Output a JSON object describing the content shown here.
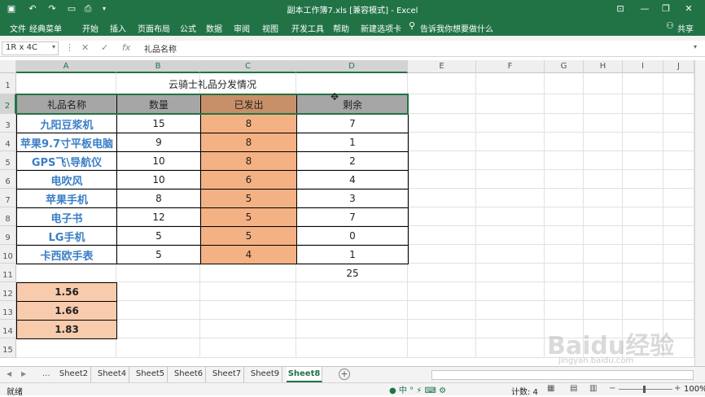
{
  "title": "副本工作簿7.xls  [兼容模式]  -  Excel",
  "window": {
    "minimize": "—",
    "restore": "❐",
    "close": "✕",
    "ribbon_toggle": "⊡"
  },
  "menu": {
    "tabs": [
      "文件",
      "经典菜单",
      "开始",
      "插入",
      "页面布局",
      "公式",
      "数据",
      "审阅",
      "视图",
      "开发工具",
      "帮助",
      "新建选项卡"
    ],
    "tell_me": "告诉我你想要做什么",
    "share": "共享"
  },
  "formula": {
    "name_box": "1R x 4C",
    "cancel": "✕",
    "enter": "✓",
    "fx": "fx",
    "content": "礼品名称"
  },
  "columns": [
    "A",
    "B",
    "C",
    "D",
    "E",
    "F",
    "G",
    "H",
    "I",
    "J"
  ],
  "rows": [
    "1",
    "2",
    "3",
    "4",
    "5",
    "6",
    "7",
    "8",
    "9",
    "10",
    "11",
    "12",
    "13",
    "14",
    "15"
  ],
  "sheet": {
    "heading": "云骑士礼品分发情况",
    "headers": [
      "礼品名称",
      "数量",
      "已发出",
      "剩余"
    ],
    "items": [
      {
        "name": "九阳豆浆机",
        "qty": "15",
        "sent": "8",
        "left": "7"
      },
      {
        "name": "苹果9.7寸平板电脑",
        "qty": "9",
        "sent": "8",
        "left": "1"
      },
      {
        "name": "GPS飞\\导航仪",
        "qty": "10",
        "sent": "8",
        "left": "2"
      },
      {
        "name": "电吹风",
        "qty": "10",
        "sent": "6",
        "left": "4"
      },
      {
        "name": "苹果手机",
        "qty": "8",
        "sent": "5",
        "left": "3"
      },
      {
        "name": "电子书",
        "qty": "12",
        "sent": "5",
        "left": "7"
      },
      {
        "name": "LG手机",
        "qty": "5",
        "sent": "5",
        "left": "0"
      },
      {
        "name": "卡西欧手表",
        "qty": "5",
        "sent": "4",
        "left": "1"
      }
    ],
    "total_left": "25",
    "ratios": [
      "1.56",
      "1.66",
      "1.83"
    ]
  },
  "tabs": [
    "Sheet2",
    "Sheet4",
    "Sheet5",
    "Sheet6",
    "Sheet7",
    "Sheet9",
    "Sheet8"
  ],
  "tab_nav": {
    "prev": "◀",
    "next": "▶",
    "more": "...",
    "add": "+"
  },
  "status": {
    "ready": "就绪",
    "count": "计数: 4",
    "zoom": "100%",
    "zoom_minus": "−",
    "zoom_plus": "+"
  },
  "watermark": "Baidu经验",
  "watermark_url": "jingyan.baidu.com",
  "colors": {
    "excel_green": "#217346",
    "header_gray": "#a6a6a6",
    "orange": "#f4b183",
    "peach": "#f8cbad",
    "name_blue": "#3a7fc6"
  }
}
